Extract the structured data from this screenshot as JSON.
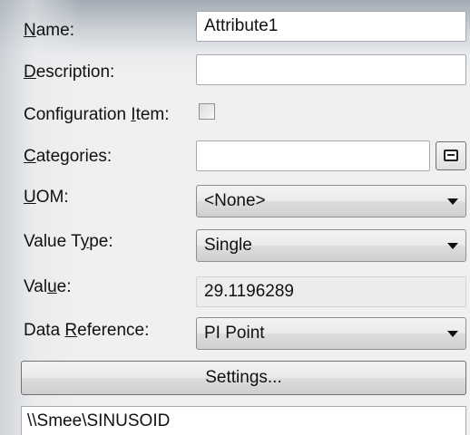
{
  "form": {
    "name": {
      "label_pre": "",
      "label_u": "N",
      "label_post": "ame:",
      "value": "Attribute1"
    },
    "description": {
      "label_pre": "",
      "label_u": "D",
      "label_post": "escription:",
      "value": ""
    },
    "configuration_item": {
      "label_pre": "Configuration ",
      "label_u": "I",
      "label_post": "tem:",
      "checked": false
    },
    "categories": {
      "label_pre": "",
      "label_u": "C",
      "label_post": "ategories:",
      "value": ""
    },
    "uom": {
      "label_pre": "",
      "label_u": "U",
      "label_post": "OM:",
      "selected": "<None>"
    },
    "value_type": {
      "label_pre": "Value T",
      "label_u": "y",
      "label_post": "pe:",
      "selected": "Single"
    },
    "value": {
      "label_pre": "Val",
      "label_u": "u",
      "label_post": "e:",
      "value": "29.1196289"
    },
    "data_reference": {
      "label_pre": "Data ",
      "label_u": "R",
      "label_post": "eference:",
      "selected": "PI Point"
    },
    "settings_button": {
      "label_pre": "",
      "label_u": "S",
      "label_post": "ettings..."
    },
    "path": "\\\\Smee\\SINUSOID"
  }
}
